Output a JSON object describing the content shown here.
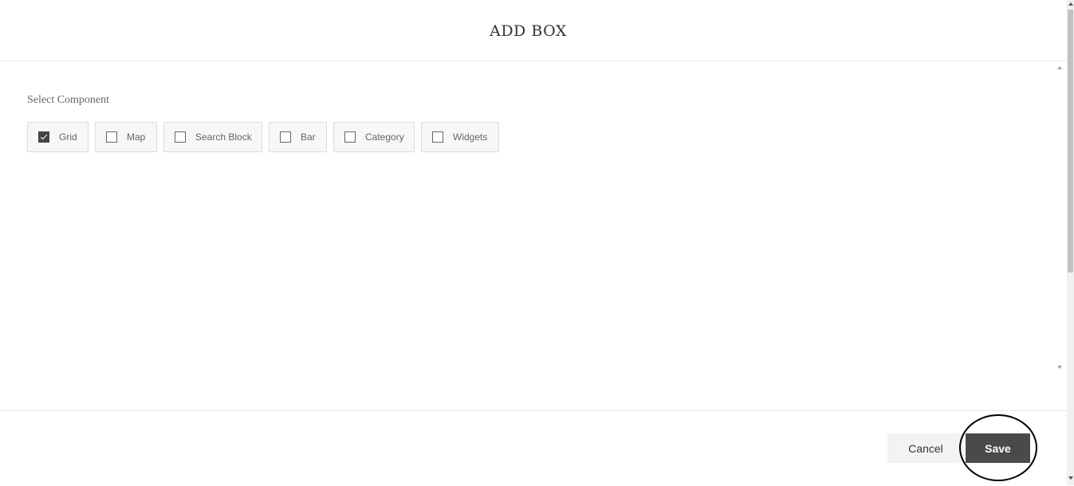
{
  "modal": {
    "title": "ADD BOX"
  },
  "component_selector": {
    "label": "Select Component",
    "options": [
      {
        "label": "Grid",
        "checked": true
      },
      {
        "label": "Map",
        "checked": false
      },
      {
        "label": "Search Block",
        "checked": false
      },
      {
        "label": "Bar",
        "checked": false
      },
      {
        "label": "Category",
        "checked": false
      },
      {
        "label": "Widgets",
        "checked": false
      }
    ]
  },
  "footer": {
    "cancel_label": "Cancel",
    "save_label": "Save"
  },
  "colors": {
    "primary_button": "#4a4a4a",
    "secondary_button": "#f3f3f3",
    "checkbox_checked": "#444444"
  },
  "icons": {
    "checkbox_checked": "checkmark-icon",
    "scroll_up": "chevron-up-icon",
    "scroll_down": "chevron-down-icon"
  }
}
